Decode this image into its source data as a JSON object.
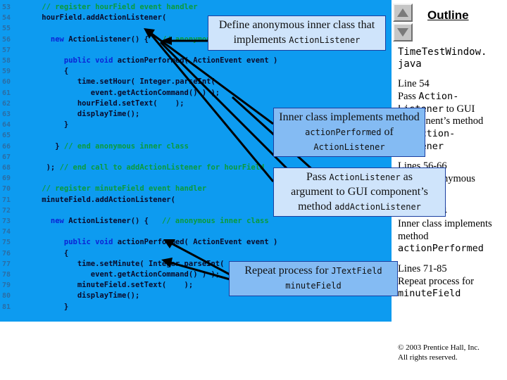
{
  "code_panel": {
    "first_line_number": 53,
    "lines": [
      {
        "n": 53,
        "indent": 4,
        "segments": [
          {
            "t": "// register hourField event handler",
            "c": "comment"
          }
        ]
      },
      {
        "n": 54,
        "indent": 4,
        "segments": [
          {
            "t": "hourField.addActionListener(",
            "c": "plain"
          }
        ]
      },
      {
        "n": 55,
        "indent": 0,
        "segments": []
      },
      {
        "n": 56,
        "indent": 6,
        "segments": [
          {
            "t": "new ",
            "c": "kw"
          },
          {
            "t": "ActionListener() {   ",
            "c": "plain"
          },
          {
            "t": "// anonymous inner class",
            "c": "comment"
          }
        ]
      },
      {
        "n": 57,
        "indent": 0,
        "segments": []
      },
      {
        "n": 58,
        "indent": 9,
        "segments": [
          {
            "t": "public void ",
            "c": "kw"
          },
          {
            "t": "actionPerformed( ActionEvent event )",
            "c": "plain"
          }
        ]
      },
      {
        "n": 59,
        "indent": 9,
        "segments": [
          {
            "t": "{",
            "c": "plain"
          }
        ]
      },
      {
        "n": 60,
        "indent": 12,
        "segments": [
          {
            "t": "time.setHour( Integer.parseInt(",
            "c": "plain"
          }
        ]
      },
      {
        "n": 61,
        "indent": 15,
        "segments": [
          {
            "t": "event.getActionCommand() ) );",
            "c": "plain"
          }
        ]
      },
      {
        "n": 62,
        "indent": 12,
        "segments": [
          {
            "t": "hourField.setText(    );",
            "c": "plain"
          }
        ]
      },
      {
        "n": 63,
        "indent": 12,
        "segments": [
          {
            "t": "displayTime();",
            "c": "plain"
          }
        ]
      },
      {
        "n": 64,
        "indent": 9,
        "segments": [
          {
            "t": "}",
            "c": "plain"
          }
        ]
      },
      {
        "n": 65,
        "indent": 0,
        "segments": []
      },
      {
        "n": 66,
        "indent": 7,
        "segments": [
          {
            "t": "} ",
            "c": "plain"
          },
          {
            "t": "// end anonymous inner class",
            "c": "comment"
          }
        ]
      },
      {
        "n": 67,
        "indent": 0,
        "segments": []
      },
      {
        "n": 68,
        "indent": 5,
        "segments": [
          {
            "t": "); ",
            "c": "plain"
          },
          {
            "t": "// end call to addActionListener for hourField",
            "c": "comment"
          }
        ]
      },
      {
        "n": 69,
        "indent": 0,
        "segments": []
      },
      {
        "n": 70,
        "indent": 4,
        "segments": [
          {
            "t": "// register minuteField event handler",
            "c": "comment"
          }
        ]
      },
      {
        "n": 71,
        "indent": 4,
        "segments": [
          {
            "t": "minuteField.addActionListener(",
            "c": "plain"
          }
        ]
      },
      {
        "n": 72,
        "indent": 0,
        "segments": []
      },
      {
        "n": 73,
        "indent": 6,
        "segments": [
          {
            "t": "new ",
            "c": "kw"
          },
          {
            "t": "ActionListener() {   ",
            "c": "plain"
          },
          {
            "t": "// anonymous inner class",
            "c": "comment"
          }
        ]
      },
      {
        "n": 74,
        "indent": 0,
        "segments": []
      },
      {
        "n": 75,
        "indent": 9,
        "segments": [
          {
            "t": "public void ",
            "c": "kw"
          },
          {
            "t": "actionPerformed( ActionEvent event )",
            "c": "plain"
          }
        ]
      },
      {
        "n": 76,
        "indent": 9,
        "segments": [
          {
            "t": "{",
            "c": "plain"
          }
        ]
      },
      {
        "n": 77,
        "indent": 12,
        "segments": [
          {
            "t": "time.setMinute( Integer.parseInt(",
            "c": "plain"
          }
        ]
      },
      {
        "n": 78,
        "indent": 15,
        "segments": [
          {
            "t": "event.getActionCommand() ) );",
            "c": "plain"
          }
        ]
      },
      {
        "n": 79,
        "indent": 12,
        "segments": [
          {
            "t": "minuteField.setText(    );",
            "c": "plain"
          }
        ]
      },
      {
        "n": 80,
        "indent": 12,
        "segments": [
          {
            "t": "displayTime();",
            "c": "plain"
          }
        ]
      },
      {
        "n": 81,
        "indent": 9,
        "segments": [
          {
            "t": "}",
            "c": "plain"
          }
        ]
      }
    ],
    "background_color": "#0d9bf0"
  },
  "callouts": [
    {
      "id": "define-anonymous-inner-class",
      "style": "pale",
      "lines": [
        [
          {
            "t": "Define anonymous inner class that",
            "m": false
          }
        ],
        [
          {
            "t": "implements ",
            "m": false
          },
          {
            "t": "ActionListener",
            "m": true
          }
        ]
      ]
    },
    {
      "id": "inner-class-implements-method",
      "style": "mid",
      "lines": [
        [
          {
            "t": "Inner class implements method",
            "m": false
          }
        ],
        [
          {
            "t": "actionPerformed",
            "m": true
          },
          {
            "t": " of",
            "m": false
          }
        ],
        [
          {
            "t": "ActionListener",
            "m": true
          }
        ]
      ]
    },
    {
      "id": "pass-actionlistener-as-argument",
      "style": "pale",
      "lines": [
        [
          {
            "t": "Pass ",
            "m": false
          },
          {
            "t": "ActionListener",
            "m": true
          },
          {
            "t": " as",
            "m": false
          }
        ],
        [
          {
            "t": "argument to GUI component’s",
            "m": false
          }
        ],
        [
          {
            "t": "method ",
            "m": false
          },
          {
            "t": "addActionListener",
            "m": true
          }
        ]
      ]
    },
    {
      "id": "repeat-process-for-minutefield",
      "style": "mid",
      "lines": [
        [
          {
            "t": "Repeat process for ",
            "m": false
          },
          {
            "t": "JTextField",
            "m": true
          }
        ],
        [
          {
            "t": "minuteField",
            "m": true
          }
        ]
      ]
    }
  ],
  "outline": {
    "title": "Outline",
    "nav_up_label": "scroll-up",
    "nav_down_label": "scroll-down",
    "file_name_line1": "TimeTestWindow.",
    "file_name_line2": "java",
    "blocks": [
      {
        "heading": "Line 54",
        "lines": [
          [
            {
              "t": "Pass ",
              "m": false
            },
            {
              "t": "Action-",
              "m": true
            }
          ],
          [
            {
              "t": "Listener",
              "m": true
            },
            {
              "t": " to GUI",
              "m": false
            }
          ],
          [
            {
              "t": "component’s method",
              "m": false
            }
          ],
          [
            {
              "t": "addAction-",
              "m": true
            }
          ],
          [
            {
              "t": "Listener",
              "m": true
            }
          ]
        ]
      },
      {
        "heading": "Lines 56-66",
        "lines": [
          [
            {
              "t": "Define anonymous",
              "m": false
            }
          ],
          [
            {
              "t": "inner class",
              "m": false
            }
          ]
        ]
      },
      {
        "heading": "Lines 58-64",
        "lines": [
          [
            {
              "t": "Inner class implements",
              "m": false
            }
          ],
          [
            {
              "t": "method",
              "m": false
            }
          ],
          [
            {
              "t": "actionPerformed",
              "m": true
            }
          ]
        ]
      },
      {
        "heading": "Lines 71-85",
        "lines": [
          [
            {
              "t": "Repeat process for",
              "m": false
            }
          ],
          [
            {
              "t": "minuteField",
              "m": true
            }
          ]
        ]
      }
    ],
    "copyright_line1": "© 2003 Prentice Hall, Inc.",
    "copyright_line2": "All rights reserved."
  }
}
